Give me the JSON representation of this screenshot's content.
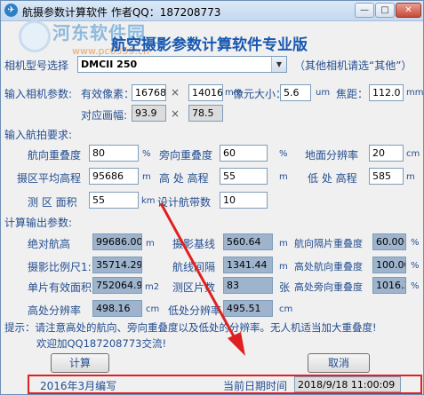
{
  "window": {
    "title": "航摄参数计算软件  作者QQ：187208773",
    "buttons": {
      "minimize": "—",
      "maximize": "□",
      "close": "✕"
    }
  },
  "watermark": {
    "main": "河东软件园",
    "sub": "www.pc0359.cn"
  },
  "heading": "航空摄影参数计算软件专业版",
  "camera": {
    "label": "相机型号选择",
    "selected": "DMCII 250",
    "note": "（其他相机请选“其他”）"
  },
  "camera_params": {
    "section_label": "输入相机参数:",
    "pixels_label": "有效像素：",
    "pixels_w": "16768",
    "x1": "×",
    "pixels_h": "14016",
    "pixel_size_unit_mm": "mm",
    "pixel_size_label": "像元大小：",
    "pixel_size": "5.6",
    "pixel_size_unit": "um",
    "focal_label": "焦距：",
    "focal": "112.0",
    "focal_unit": "mm",
    "frame_label": "对应画幅:",
    "frame_w": "93.9",
    "x2": "×",
    "frame_h": "78.5"
  },
  "flight_req": {
    "section_label": "输入航拍要求:",
    "forward_overlap_label": "航向重叠度",
    "forward_overlap": "80",
    "pct1": "%",
    "side_overlap_label": "旁向重叠度",
    "side_overlap": "60",
    "pct2": "%",
    "gsd_label": "地面分辨率",
    "gsd": "20",
    "cm": "cm",
    "avg_elev_label": "摄区平均高程",
    "avg_elev": "95686",
    "m1": "m",
    "high_elev_label": "高 处 高程",
    "high_elev": "55",
    "m2": "m",
    "low_elev_label": "低 处 高程",
    "low_elev": "585",
    "m3": "m",
    "area_label": "测 区 面积",
    "area": "55",
    "area_unit": "km",
    "strips_label": "设计航带数",
    "strips": "10"
  },
  "output": {
    "section_label": "计算输出参数:",
    "abs_height_label": "绝对航高",
    "abs_height": "99686.00",
    "abs_height_unit": "m",
    "baseline_label": "摄影基线",
    "baseline": "560.64",
    "baseline_unit": "m",
    "high_forward_label": "航向隔片重叠度",
    "high_forward": "60.00",
    "pct_a": "%",
    "scale_label": "摄影比例尺1:",
    "scale": "35714.29",
    "strip_spacing_label": "航线间隔",
    "strip_spacing": "1341.44",
    "strip_spacing_unit": "m",
    "high_fwd2_label": "高处航向重叠度",
    "high_fwd2": "100.00",
    "pct_b": "%",
    "photo_area_label": "单片有效面积",
    "photo_area": "752064.92",
    "photo_area_unit": "m2",
    "photo_count_label": "测区片数",
    "photo_count": "83",
    "photo_count_unit": "张",
    "high_side_label": "高处旁向重叠度",
    "high_side": "1016.3",
    "pct_c": "%",
    "high_gsd_label": "高处分辨率",
    "high_gsd": "498.16",
    "high_gsd_unit": "cm",
    "low_gsd_label": "低处分辨率",
    "low_gsd": "495.51",
    "low_gsd_unit": "cm"
  },
  "hint": {
    "line1": "提示：请注意高处的航向、旁向重叠度以及低处的分辨率。无人机适当加大重叠度!",
    "line2": "欢迎加QQ187208773交流!"
  },
  "buttons": {
    "calculate": "计算",
    "cancel": "取消"
  },
  "statusbar": {
    "version": "2016年3月编写",
    "datetime_label": "当前日期时间",
    "datetime": "2018/9/18 11:00:09"
  },
  "colors": {
    "label": "#244e91",
    "heading": "#1858b0",
    "output_bg": "#9eb3cc",
    "highlight": "#e02020"
  }
}
